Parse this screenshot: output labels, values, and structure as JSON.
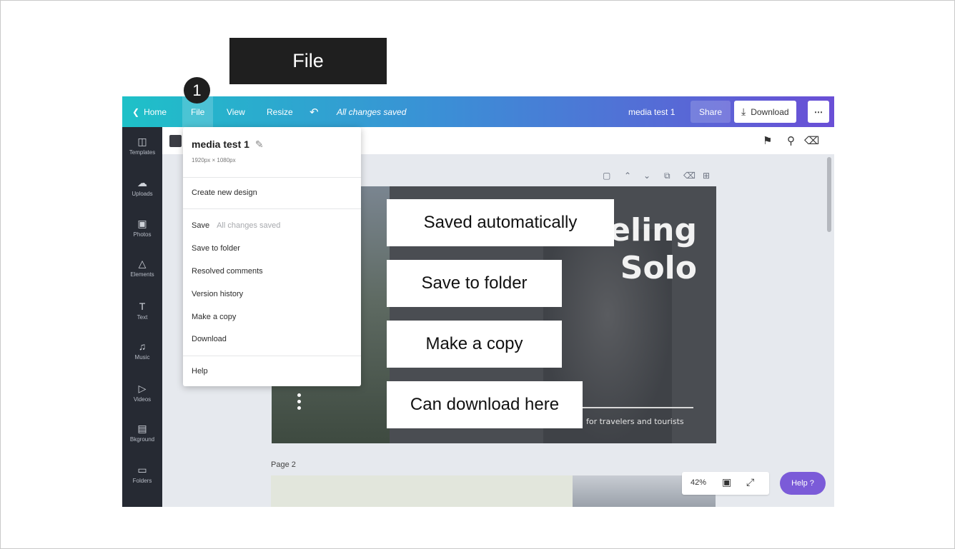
{
  "callout_title": "File",
  "step_number": "1",
  "topbar": {
    "home": "Home",
    "file": "File",
    "view": "View",
    "resize": "Resize",
    "status": "All changes saved",
    "design_name": "media test 1",
    "share": "Share",
    "download": "Download",
    "more": "⋯"
  },
  "sidebar": {
    "items": [
      {
        "label": "Templates",
        "icon": "templates-icon"
      },
      {
        "label": "Uploads",
        "icon": "upload-cloud-icon"
      },
      {
        "label": "Photos",
        "icon": "photo-icon"
      },
      {
        "label": "Elements",
        "icon": "shapes-icon"
      },
      {
        "label": "Text",
        "icon": "text-icon"
      },
      {
        "label": "Music",
        "icon": "music-note-icon"
      },
      {
        "label": "Videos",
        "icon": "video-icon"
      },
      {
        "label": "Bkground",
        "icon": "background-icon"
      },
      {
        "label": "Folders",
        "icon": "folder-icon"
      }
    ]
  },
  "file_menu": {
    "title": "media test 1",
    "dimensions": "1920px × 1080px",
    "create": "Create new design",
    "save": "Save",
    "save_status": "All changes saved",
    "save_to_folder": "Save to folder",
    "resolved_comments": "Resolved comments",
    "version_history": "Version history",
    "make_copy": "Make a copy",
    "download": "Download",
    "help": "Help"
  },
  "design": {
    "headline_line1": "eling",
    "headline_line2": "Solo",
    "tagline": "for travelers and tourists"
  },
  "page2_label": "Page 2",
  "zoom": "42%",
  "help_button": "Help ?",
  "callouts": {
    "saved": "Saved automatically",
    "save_folder": "Save to folder",
    "make_copy": "Make a copy",
    "download": "Can download here"
  }
}
